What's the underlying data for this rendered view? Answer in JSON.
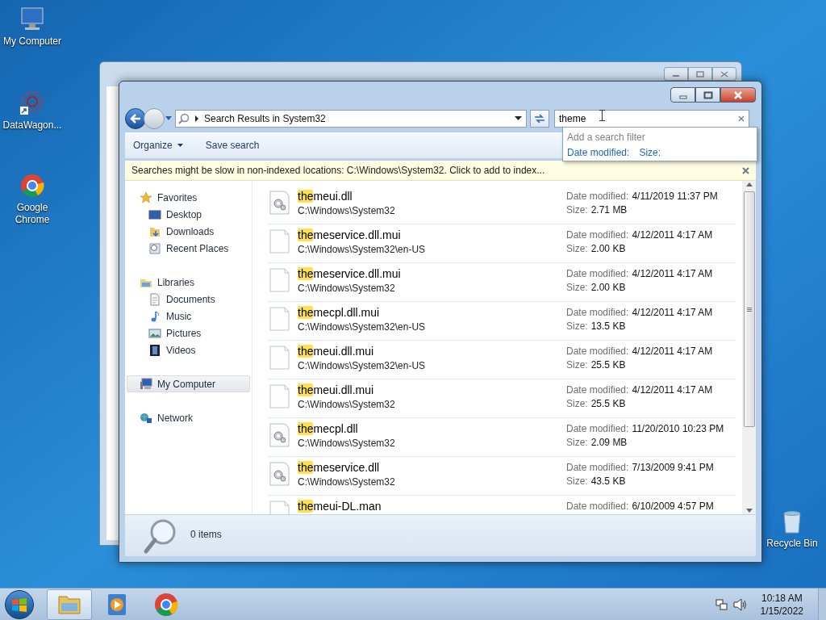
{
  "desktop_icons": [
    {
      "label": "My Computer",
      "kind": "computer"
    },
    {
      "label": "DataWagon...",
      "kind": "datawagon"
    },
    {
      "label": "Google Chrome",
      "kind": "chrome"
    },
    {
      "label": "Recycle Bin",
      "kind": "recycle"
    }
  ],
  "window": {
    "address": "Search Results in System32",
    "search": {
      "value": "theme"
    },
    "search_filter": {
      "title": "Add a search filter",
      "filters": [
        "Date modified:",
        "Size:"
      ]
    },
    "toolbar": [
      {
        "label": "Organize",
        "has_menu": true
      },
      {
        "label": "Save search",
        "has_menu": false
      }
    ],
    "info_bar": "Searches might be slow in non-indexed locations: C:\\Windows\\System32. Click to add to index...",
    "sidebar": [
      {
        "label": "Favorites",
        "kind": "star",
        "selected": false,
        "children": [
          {
            "label": "Desktop",
            "kind": "desktop",
            "selected": false
          },
          {
            "label": "Downloads",
            "kind": "downloads",
            "selected": false
          },
          {
            "label": "Recent Places",
            "kind": "recent",
            "selected": false
          }
        ]
      },
      {
        "label": "Libraries",
        "kind": "library",
        "selected": false,
        "children": [
          {
            "label": "Documents",
            "kind": "documents",
            "selected": false
          },
          {
            "label": "Music",
            "kind": "music",
            "selected": false
          },
          {
            "label": "Pictures",
            "kind": "pictures",
            "selected": false
          },
          {
            "label": "Videos",
            "kind": "videos",
            "selected": false
          }
        ]
      },
      {
        "label": "My Computer",
        "kind": "computer",
        "selected": true
      },
      {
        "label": "Network",
        "kind": "network",
        "selected": false
      }
    ],
    "results": [
      {
        "kind": "dll",
        "match": "the",
        "rest": "meui.dll",
        "folder": "C:\\Windows\\System32",
        "date_label": "Date modified:",
        "date": "4/11/2019 11:37 PM",
        "size_label": "Size:",
        "size": "2.71 MB"
      },
      {
        "kind": "file",
        "match": "the",
        "rest": "meservice.dll.mui",
        "folder": "C:\\Windows\\System32\\en-US",
        "date_label": "Date modified:",
        "date": "4/12/2011 4:17 AM",
        "size_label": "Size:",
        "size": "2.00 KB"
      },
      {
        "kind": "file",
        "match": "the",
        "rest": "meservice.dll.mui",
        "folder": "C:\\Windows\\System32",
        "date_label": "Date modified:",
        "date": "4/12/2011 4:17 AM",
        "size_label": "Size:",
        "size": "2.00 KB"
      },
      {
        "kind": "file",
        "match": "the",
        "rest": "mecpl.dll.mui",
        "folder": "C:\\Windows\\System32\\en-US",
        "date_label": "Date modified:",
        "date": "4/12/2011 4:17 AM",
        "size_label": "Size:",
        "size": "13.5 KB"
      },
      {
        "kind": "file",
        "match": "the",
        "rest": "meui.dll.mui",
        "folder": "C:\\Windows\\System32\\en-US",
        "date_label": "Date modified:",
        "date": "4/12/2011 4:17 AM",
        "size_label": "Size:",
        "size": "25.5 KB"
      },
      {
        "kind": "file",
        "match": "the",
        "rest": "meui.dll.mui",
        "folder": "C:\\Windows\\System32",
        "date_label": "Date modified:",
        "date": "4/12/2011 4:17 AM",
        "size_label": "Size:",
        "size": "25.5 KB"
      },
      {
        "kind": "dll",
        "match": "the",
        "rest": "mecpl.dll",
        "folder": "C:\\Windows\\System32",
        "date_label": "Date modified:",
        "date": "11/20/2010 10:23 PM",
        "size_label": "Size:",
        "size": "2.09 MB"
      },
      {
        "kind": "dll",
        "match": "the",
        "rest": "meservice.dll",
        "folder": "C:\\Windows\\System32",
        "date_label": "Date modified:",
        "date": "7/13/2009 9:41 PM",
        "size_label": "Size:",
        "size": "43.5 KB"
      },
      {
        "kind": "file",
        "match": "the",
        "rest": "meui-DL.man",
        "date_label": "Date modified:",
        "date": "6/10/2009 4:57 PM"
      }
    ],
    "status": "0 items"
  },
  "taskbar": {
    "apps": [
      {
        "kind": "explorer",
        "selected": true
      },
      {
        "kind": "media",
        "selected": false
      },
      {
        "kind": "chrome",
        "selected": false
      }
    ],
    "time": "10:18 AM",
    "date": "1/15/2022"
  }
}
